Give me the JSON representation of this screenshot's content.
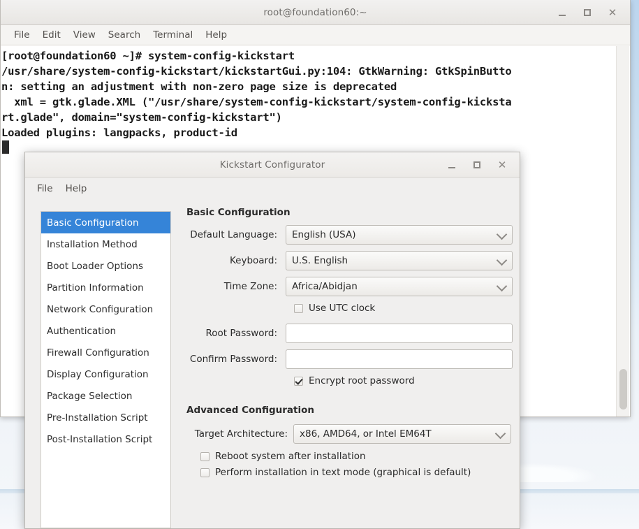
{
  "terminal": {
    "title": "root@foundation60:~",
    "menu": [
      "File",
      "Edit",
      "View",
      "Search",
      "Terminal",
      "Help"
    ],
    "output": "[root@foundation60 ~]# system-config-kickstart\n/usr/share/system-config-kickstart/kickstartGui.py:104: GtkWarning: GtkSpinButto\nn: setting an adjustment with non-zero page size is deprecated\n  xml = gtk.glade.XML (\"/usr/share/system-config-kickstart/system-config-kicksta\nrt.glade\", domain=\"system-config-kickstart\")\nLoaded plugins: langpacks, product-id",
    "controls": {
      "minimize": "minimize",
      "maximize": "maximize",
      "close": "close"
    }
  },
  "dialog": {
    "title": "Kickstart Configurator",
    "menu": [
      "File",
      "Help"
    ],
    "sidebar": {
      "items": [
        {
          "label": "Basic Configuration",
          "selected": true
        },
        {
          "label": "Installation Method",
          "selected": false
        },
        {
          "label": "Boot Loader Options",
          "selected": false
        },
        {
          "label": "Partition Information",
          "selected": false
        },
        {
          "label": "Network Configuration",
          "selected": false
        },
        {
          "label": "Authentication",
          "selected": false
        },
        {
          "label": "Firewall Configuration",
          "selected": false
        },
        {
          "label": "Display Configuration",
          "selected": false
        },
        {
          "label": "Package Selection",
          "selected": false
        },
        {
          "label": "Pre-Installation Script",
          "selected": false
        },
        {
          "label": "Post-Installation Script",
          "selected": false
        }
      ]
    },
    "basic": {
      "heading": "Basic Configuration",
      "language_label": "Default Language:",
      "language_value": "English (USA)",
      "keyboard_label": "Keyboard:",
      "keyboard_value": "U.S. English",
      "timezone_label": "Time Zone:",
      "timezone_value": "Africa/Abidjan",
      "utc_label": "Use UTC clock",
      "utc_checked": false,
      "root_password_label": "Root Password:",
      "root_password_value": "",
      "confirm_password_label": "Confirm Password:",
      "confirm_password_value": "",
      "encrypt_label": "Encrypt root password",
      "encrypt_checked": true
    },
    "advanced": {
      "heading": "Advanced Configuration",
      "arch_label": "Target Architecture:",
      "arch_value": "x86, AMD64, or Intel EM64T",
      "reboot_label": "Reboot system after installation",
      "reboot_checked": false,
      "textmode_label": "Perform installation in text mode (graphical is default)",
      "textmode_checked": false
    }
  },
  "colors": {
    "selection_blue": "#3584d8",
    "dialog_bg": "#f0efee",
    "terminal_bg": "#ffffff",
    "terminal_fg": "#1a1a1a"
  }
}
